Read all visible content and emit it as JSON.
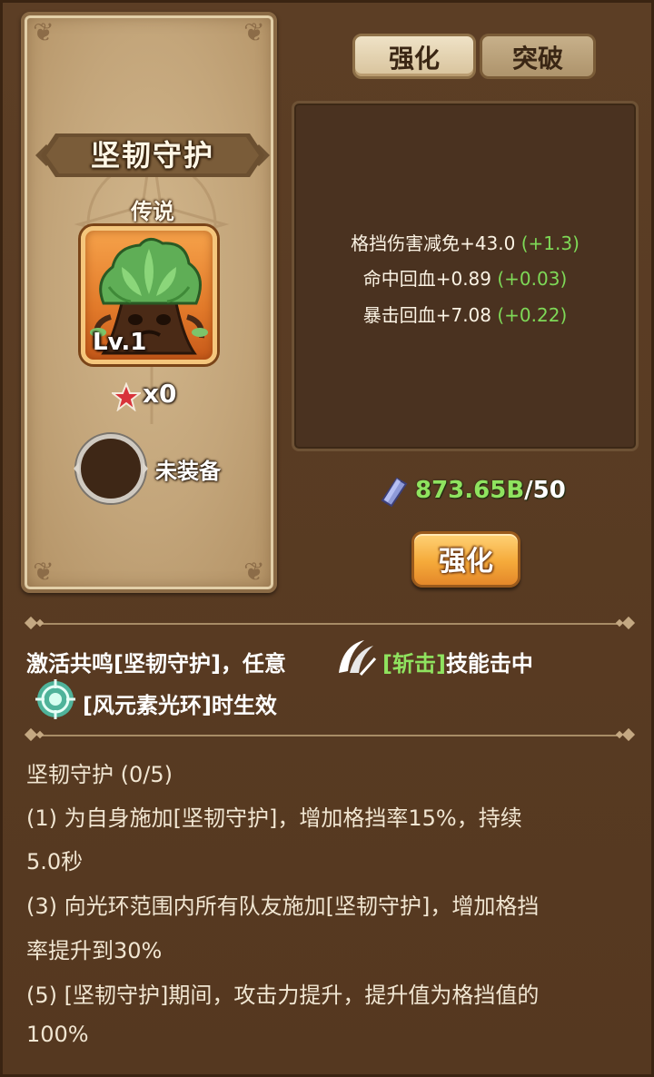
{
  "tabs": [
    {
      "label": "强化",
      "active": true
    },
    {
      "label": "突破",
      "active": false
    }
  ],
  "item": {
    "name": "坚韧守护",
    "rarity": "传说",
    "level": "Lv.1",
    "star_count": "x0",
    "equip_status": "未装备"
  },
  "stats": [
    {
      "text": "格挡伤害减免+43.0",
      "bonus": "(+1.3)"
    },
    {
      "text": "命中回血+0.89",
      "bonus": "(+0.03)"
    },
    {
      "text": "暴击回血+7.08",
      "bonus": "(+0.22)"
    }
  ],
  "cost": {
    "have": "873.65B",
    "slash": "/",
    "need": "50"
  },
  "enhance_button": "强化",
  "resonance": {
    "line1_prefix": "激活共鸣[坚韧守护]，任意",
    "skill": "[斩击]",
    "line1_suffix": "技能击中",
    "line2": "[风元素光环]时生效"
  },
  "set": {
    "header": "坚韧守护 (0/5)",
    "lines": [
      " (1) 为自身施加[坚韧守护]，增加格挡率15%，持续",
      "5.0秒",
      " (3) 向光环范围内所有队友施加[坚韧守护]，增加格挡",
      "率提升到30%",
      " (5) [坚韧守护]期间，攻击力提升，提升值为格挡值的",
      "100%"
    ]
  },
  "colors": {
    "bonus_green": "#7ed957",
    "accent_orange": "#f5aa3a",
    "card_tan": "#c3a57a"
  },
  "icons": [
    "ent-tree-icon",
    "star-icon",
    "crystal-icon",
    "slash-skill-icon",
    "wind-aura-icon"
  ]
}
